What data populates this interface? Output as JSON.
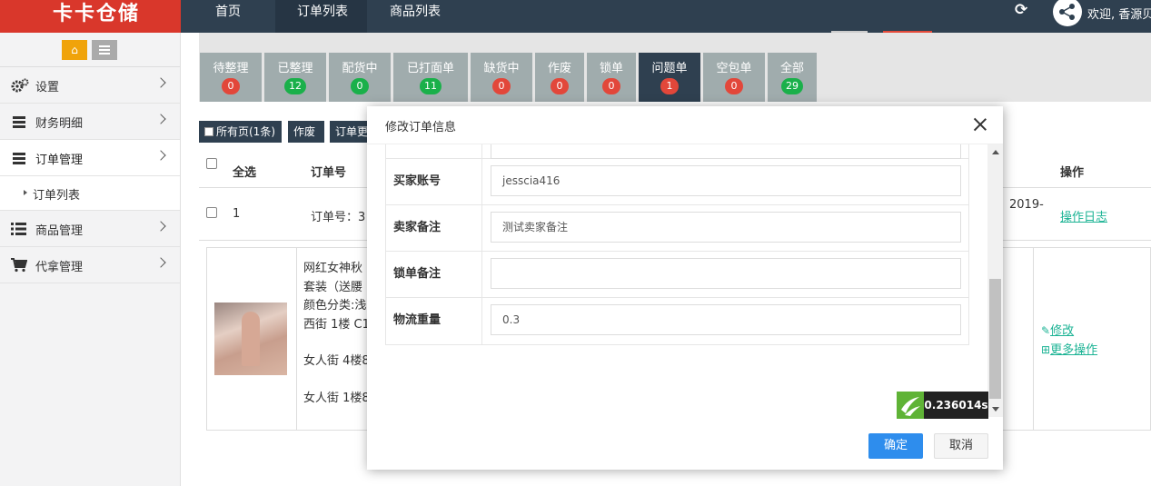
{
  "app": {
    "logo_text": "卡卡仓储"
  },
  "topnav": {
    "items": [
      {
        "label": "首页"
      },
      {
        "label": "订单列表"
      },
      {
        "label": "商品列表"
      }
    ]
  },
  "header": {
    "welcome": "欢迎, 香源贝"
  },
  "sidebar": {
    "items": [
      {
        "label": "设置",
        "icon": "gear-icon"
      },
      {
        "label": "财务明细",
        "icon": "list-icon"
      },
      {
        "label": "订单管理",
        "icon": "list-icon"
      },
      {
        "label": "商品管理",
        "icon": "list-icon"
      },
      {
        "label": "代拿管理",
        "icon": "cart-icon"
      }
    ],
    "sub_items": [
      {
        "label": "订单列表"
      }
    ]
  },
  "status_tabs": [
    {
      "label": "待整理",
      "count": "0",
      "badge": "red"
    },
    {
      "label": "已整理",
      "count": "12",
      "badge": "green"
    },
    {
      "label": "配货中",
      "count": "0",
      "badge": "green"
    },
    {
      "label": "已打面单",
      "count": "11",
      "badge": "green"
    },
    {
      "label": "缺货中",
      "count": "0",
      "badge": "red"
    },
    {
      "label": "作废",
      "count": "0",
      "badge": "red"
    },
    {
      "label": "锁单",
      "count": "0",
      "badge": "red"
    },
    {
      "label": "问题单",
      "count": "1",
      "badge": "red",
      "active": true
    },
    {
      "label": "空包单",
      "count": "0",
      "badge": "red"
    },
    {
      "label": "全部",
      "count": "29",
      "badge": "green"
    }
  ],
  "toolbar": {
    "select_all_pages": "所有页(1条)",
    "void": "作废",
    "order_more": "订单更"
  },
  "table": {
    "headers": {
      "select_all": "全选",
      "order_no": "订单号",
      "actions": "操作"
    },
    "row": {
      "index": "1",
      "order_no": "订单号：3",
      "date": "2019-",
      "log_link": "操作日志"
    }
  },
  "detail": {
    "lines": [
      "网红女神秋",
      "套装（送腰",
      "颜色分类:浅",
      "西街 1楼 C1",
      "女人街 4楼8",
      "女人街 1楼8"
    ],
    "edit_link": "修改",
    "more_link": "更多操作"
  },
  "modal": {
    "title": "修改订单信息",
    "fields": [
      {
        "label": "买家账号",
        "value": "jesscia416"
      },
      {
        "label": "卖家备注",
        "value": "测试卖家备注"
      },
      {
        "label": "锁单备注",
        "value": ""
      },
      {
        "label": "物流重量",
        "value": "0.3"
      }
    ],
    "timer": "0.236014s",
    "confirm": "确定",
    "cancel": "取消"
  },
  "colors": {
    "brand_red": "#d9372b",
    "nav_dark": "#2f4050",
    "green": "#1ab04a",
    "primary": "#2e8ded",
    "link": "#1bb394"
  }
}
